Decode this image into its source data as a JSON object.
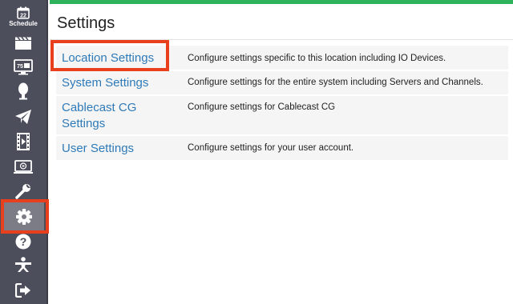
{
  "sidebar": {
    "items": [
      {
        "name": "schedule",
        "label": "Schedule",
        "day": "22"
      },
      {
        "name": "clapperboard"
      },
      {
        "name": "channel-monitor",
        "badge": "75"
      },
      {
        "name": "microphone"
      },
      {
        "name": "paper-plane"
      },
      {
        "name": "film"
      },
      {
        "name": "player-monitor"
      },
      {
        "name": "wrench"
      },
      {
        "name": "gear",
        "active": true
      },
      {
        "name": "help"
      },
      {
        "name": "figure"
      },
      {
        "name": "sign-out"
      }
    ]
  },
  "page": {
    "title": "Settings"
  },
  "settings": [
    {
      "label": "Location Settings",
      "description": "Configure settings specific to this location including IO Devices."
    },
    {
      "label": "System Settings",
      "description": "Configure settings for the entire system including Servers and Channels."
    },
    {
      "label_line1": "Cablecast CG",
      "label_line2": "Settings",
      "description": "Configure settings for Cablecast CG"
    },
    {
      "label": "User Settings",
      "description": "Configure settings for your user account."
    }
  ],
  "colors": {
    "sidebar": "#4d4e5c",
    "accent_bar": "#2eb25b",
    "link": "#2e7ab8",
    "highlight": "#e8401c"
  }
}
